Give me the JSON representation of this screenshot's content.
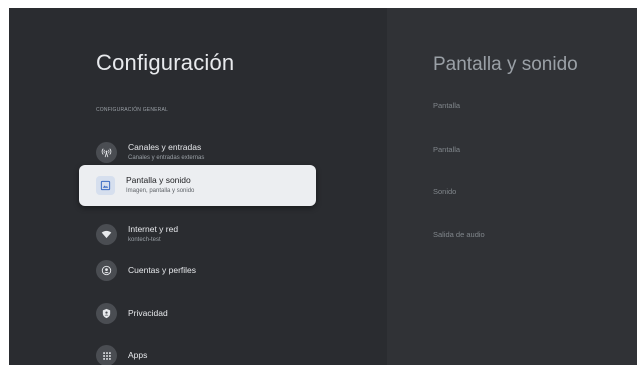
{
  "settings": {
    "title": "Configuración",
    "section_header": "CONFIGURACIÓN GENERAL",
    "items": [
      {
        "label": "Canales y entradas",
        "sub": "Canales y entradas externas",
        "icon": "antenna-icon"
      },
      {
        "label": "Pantalla y sonido",
        "sub": "Imagen, pantalla y sonido",
        "icon": "picture-icon"
      },
      {
        "label": "Internet y red",
        "sub": "kontech-test",
        "icon": "wifi-icon"
      },
      {
        "label": "Cuentas y perfiles",
        "sub": "",
        "icon": "account-icon"
      },
      {
        "label": "Privacidad",
        "sub": "",
        "icon": "shield-icon"
      },
      {
        "label": "Apps",
        "sub": "",
        "icon": "apps-grid-icon"
      }
    ],
    "selected_index": 1
  },
  "detail": {
    "title": "Pantalla y sonido",
    "items": [
      "Pantalla",
      "Pantalla",
      "Sonido",
      "Salida de audio"
    ]
  },
  "colors": {
    "background": "#2a2c30",
    "detail_background": "#303236",
    "selected_background": "#eceef1"
  }
}
